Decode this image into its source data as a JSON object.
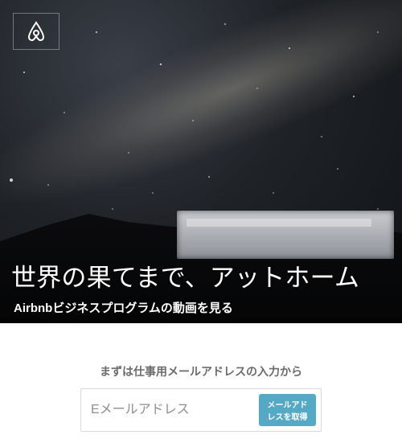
{
  "brand": {
    "logo_icon": "airbnb-logo-icon"
  },
  "hero": {
    "title": "世界の果てまで、アットホーム",
    "link": "Airbnbビジネスプログラムの動画を見る"
  },
  "signup": {
    "prompt": "まずは仕事用メールアドレスの入力から",
    "email_placeholder": "Eメールアドレス",
    "submit_label": "メールアドレスを取得"
  },
  "colors": {
    "accent": "#55a9c5",
    "prompt_text": "#6b6b6b"
  }
}
